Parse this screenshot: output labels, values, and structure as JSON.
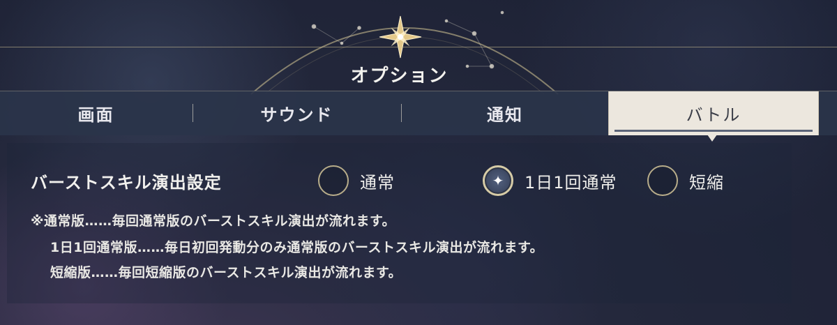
{
  "header": {
    "title": "オプション"
  },
  "tabs": [
    {
      "label": "画面",
      "active": false
    },
    {
      "label": "サウンド",
      "active": false
    },
    {
      "label": "通知",
      "active": false
    },
    {
      "label": "バトル",
      "active": true
    }
  ],
  "setting": {
    "label": "バーストスキル演出設定",
    "options": [
      {
        "label": "通常",
        "selected": false
      },
      {
        "label": "1日1回通常",
        "selected": true
      },
      {
        "label": "短縮",
        "selected": false
      }
    ],
    "notes": [
      "※通常版……毎回通常版のバーストスキル演出が流れます。",
      "1日1回通常版……毎日初回発動分のみ通常版のバーストスキル演出が流れます。",
      "短縮版……毎回短縮版のバーストスキル演出が流れます。"
    ]
  },
  "icons": {
    "header": "compass-star-icon",
    "selected_radio": "sparkle-icon"
  },
  "colors": {
    "accent_gold": "#d6cba6",
    "tab_active_bg": "#ece7de",
    "tab_bar_bg": "#2a344a"
  }
}
